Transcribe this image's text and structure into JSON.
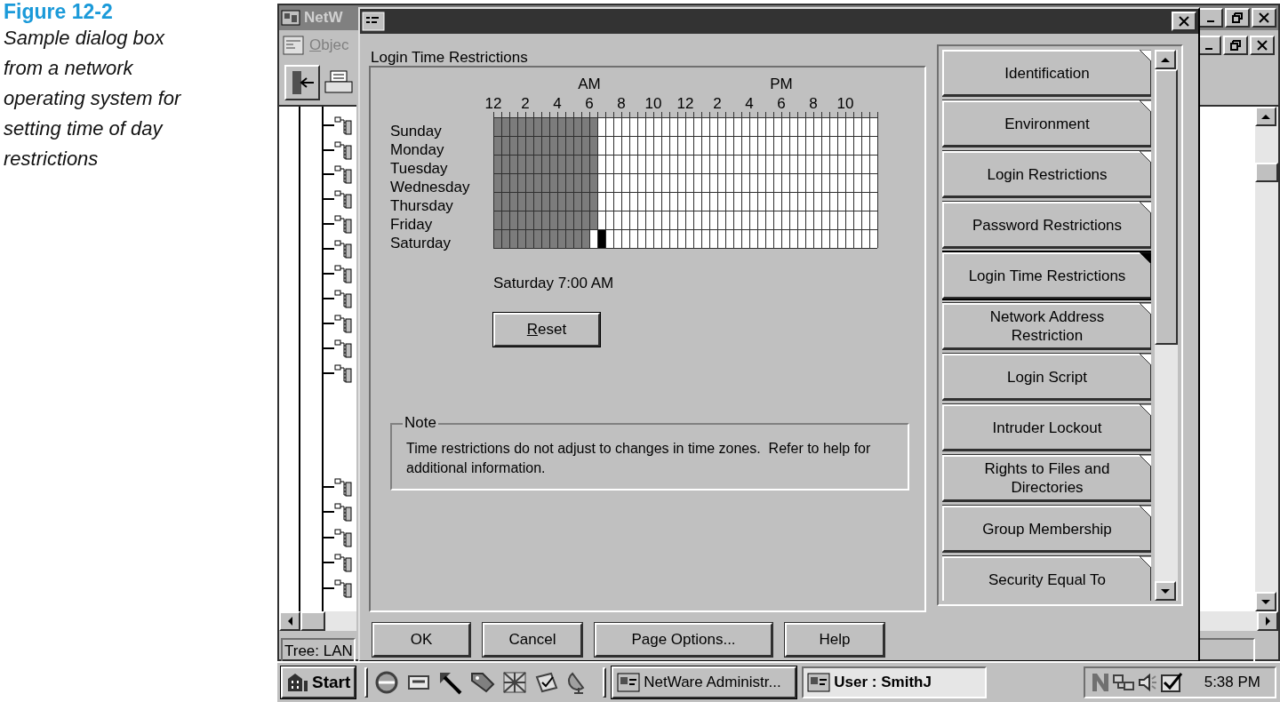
{
  "figure": {
    "label": "Figure 12-2",
    "caption": "Sample dialog box from a network operating system for setting time of day restrictions"
  },
  "background_window": {
    "title": "NetW",
    "menu": "Objec",
    "status": "Tree: LAN"
  },
  "dialog": {
    "heading": "Login Time Restrictions",
    "grid": {
      "periods": [
        "AM",
        "PM"
      ],
      "hours": [
        "12",
        "2",
        "4",
        "6",
        "8",
        "10",
        "12",
        "2",
        "4",
        "6",
        "8",
        "10"
      ],
      "days": [
        {
          "name": "Sunday",
          "level": 0.2708
        },
        {
          "name": "Monday",
          "level": 0.2708
        },
        {
          "name": "Tuesday",
          "level": 0.2708
        },
        {
          "name": "Wednesday",
          "level": 0.2708
        },
        {
          "name": "Thursday",
          "level": 0.2708
        },
        {
          "name": "Friday",
          "level": 0.2708
        },
        {
          "name": "Saturday",
          "level": 0.25
        }
      ],
      "cursor": {
        "level": 0.2708
      }
    },
    "status": "Saturday 7:00 AM",
    "reset_button": "Reset",
    "note": {
      "title": "Note",
      "text": "Time restrictions do not adjust to changes in time zones.  Refer to help for additional information."
    },
    "pages": [
      {
        "label": "Identification",
        "selected": false
      },
      {
        "label": "Environment",
        "selected": false
      },
      {
        "label": "Login Restrictions",
        "selected": false
      },
      {
        "label": "Password Restrictions",
        "selected": false
      },
      {
        "label": "Login Time Restrictions",
        "selected": true
      },
      {
        "label": "Network Address\nRestriction",
        "selected": false
      },
      {
        "label": "Login Script",
        "selected": false
      },
      {
        "label": "Intruder Lockout",
        "selected": false
      },
      {
        "label": "Rights to Files and\nDirectories",
        "selected": false
      },
      {
        "label": "Group Membership",
        "selected": false
      },
      {
        "label": "Security Equal To",
        "selected": false
      }
    ],
    "buttons": [
      "OK",
      "Cancel",
      "Page Options...",
      "Help"
    ]
  },
  "taskbar": {
    "start": "Start",
    "tasks": [
      {
        "label": "NetWare Administr...",
        "selected": false
      },
      {
        "label": "User : SmithJ",
        "selected": true
      }
    ],
    "clock": "5:38 PM"
  }
}
